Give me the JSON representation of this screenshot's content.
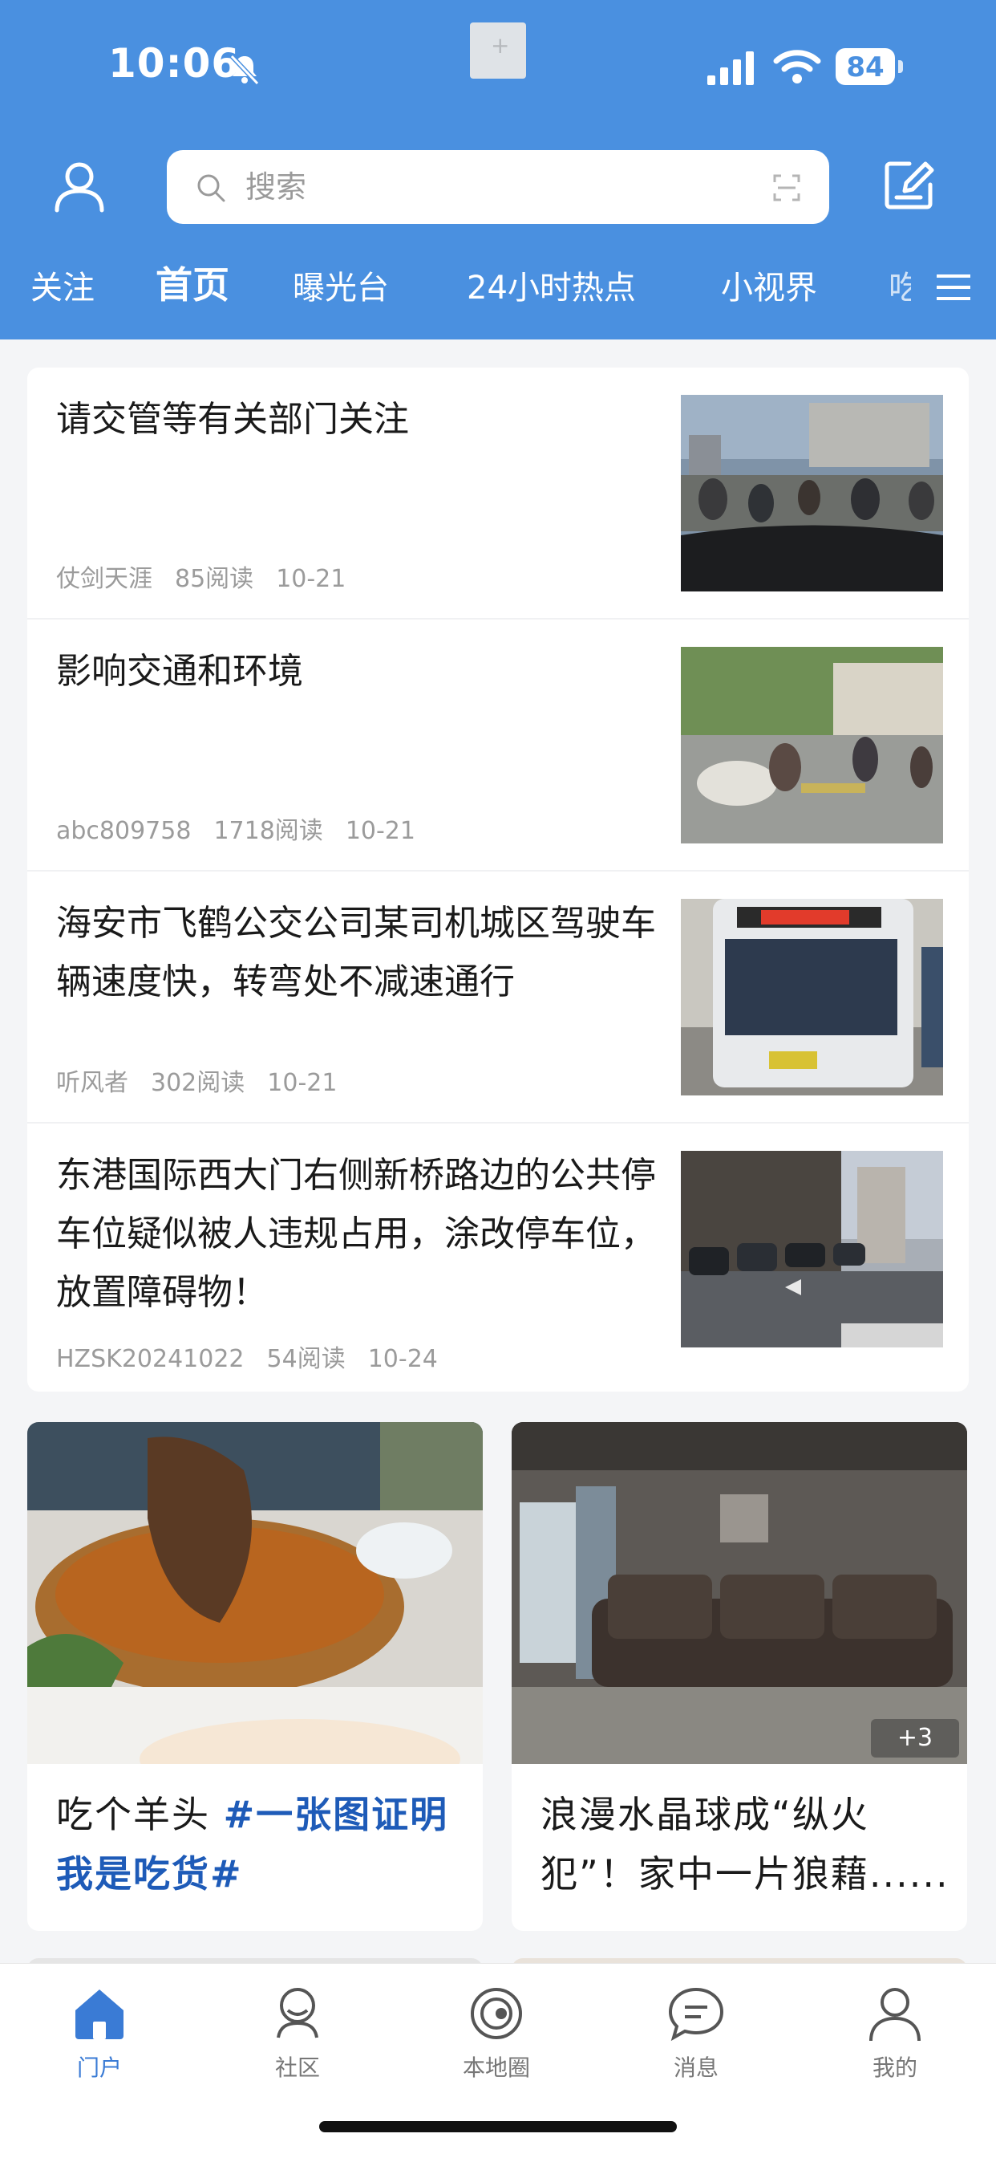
{
  "status_bar": {
    "time": "10:06",
    "battery": "84"
  },
  "search": {
    "placeholder": "搜索"
  },
  "tabs": [
    {
      "label": "关注"
    },
    {
      "label": "首页"
    },
    {
      "label": "曝光台"
    },
    {
      "label": "24小时热点"
    },
    {
      "label": "小视界"
    },
    {
      "label": "吃"
    }
  ],
  "articles": [
    {
      "title": "请交管等有关部门关注",
      "author": "仗剑天涯",
      "reads": "85阅读",
      "date": "10-21"
    },
    {
      "title": "影响交通和环境",
      "author": "abc809758",
      "reads": "1718阅读",
      "date": "10-21"
    },
    {
      "title": "海安市飞鹤公交公司某司机城区驾驶车辆速度快，转弯处不减速通行",
      "author": "听风者",
      "reads": "302阅读",
      "date": "10-21"
    },
    {
      "title": "东港国际西大门右侧新桥路边的公共停车位疑似被人违规占用，涂改停车位，放置障碍物！",
      "author": "HZSK20241022",
      "reads": "54阅读",
      "date": "10-24"
    }
  ],
  "cards": [
    {
      "title_text": "吃个羊头 ",
      "hashtag": "#一张图证明我是吃货#"
    },
    {
      "title_text": "浪漫水晶球成“纵火犯”！家中一片狼藉......",
      "hashtag": "",
      "badge": "+3"
    }
  ],
  "bottom_nav": [
    {
      "label": "门户",
      "icon": "home-icon",
      "active": true
    },
    {
      "label": "社区",
      "icon": "community-icon",
      "active": false
    },
    {
      "label": "本地圈",
      "icon": "local-circle-icon",
      "active": false
    },
    {
      "label": "消息",
      "icon": "message-icon",
      "active": false
    },
    {
      "label": "我的",
      "icon": "profile-icon",
      "active": false
    }
  ],
  "colors": {
    "header": "#4a90e0",
    "hashtag": "#1e5bb8",
    "nav_active": "#3a7bd5"
  }
}
